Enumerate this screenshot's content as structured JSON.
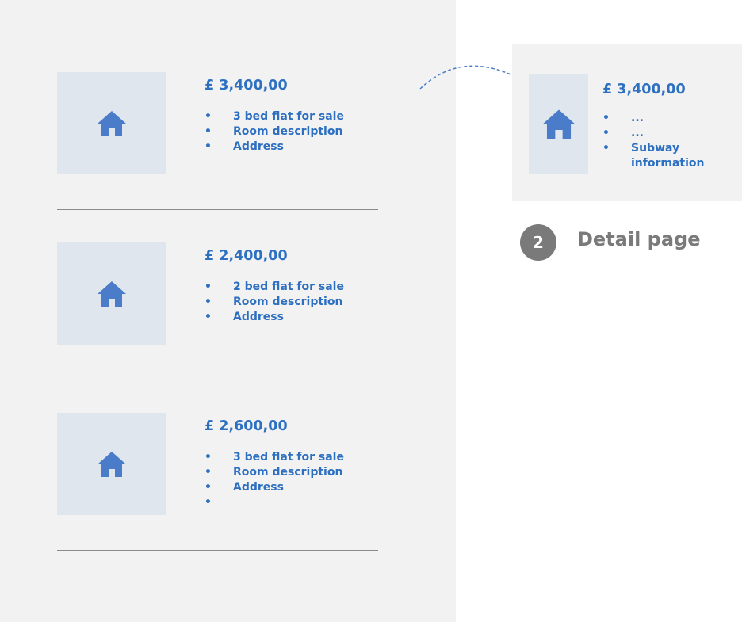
{
  "colors": {
    "accent": "#2d6fc0",
    "icon": "#4a7cc9",
    "panel_bg": "#f2f2f2",
    "thumb_bg": "#dfe6ee",
    "muted": "#7a7a7a"
  },
  "listings": [
    {
      "price": "£ 3,400,00",
      "bullet_char": "•",
      "bullets": [
        "3 bed flat for sale",
        "Room description",
        "Address"
      ],
      "icon": "house-icon"
    },
    {
      "price": "£ 2,400,00",
      "bullet_char": "•",
      "bullets": [
        "2 bed flat for sale",
        "Room description",
        "Address"
      ],
      "icon": "house-icon"
    },
    {
      "price": "£ 2,600,00",
      "bullet_char": "•",
      "bullets": [
        "3 bed flat for sale",
        "Room description",
        "Address",
        ""
      ],
      "icon": "house-icon"
    }
  ],
  "detail": {
    "price": "£ 3,400,00",
    "bullet_char": "•",
    "bullets": [
      "...",
      "...",
      "Subway information"
    ],
    "icon": "house-icon"
  },
  "step": {
    "number": "2",
    "label": "Detail page"
  }
}
